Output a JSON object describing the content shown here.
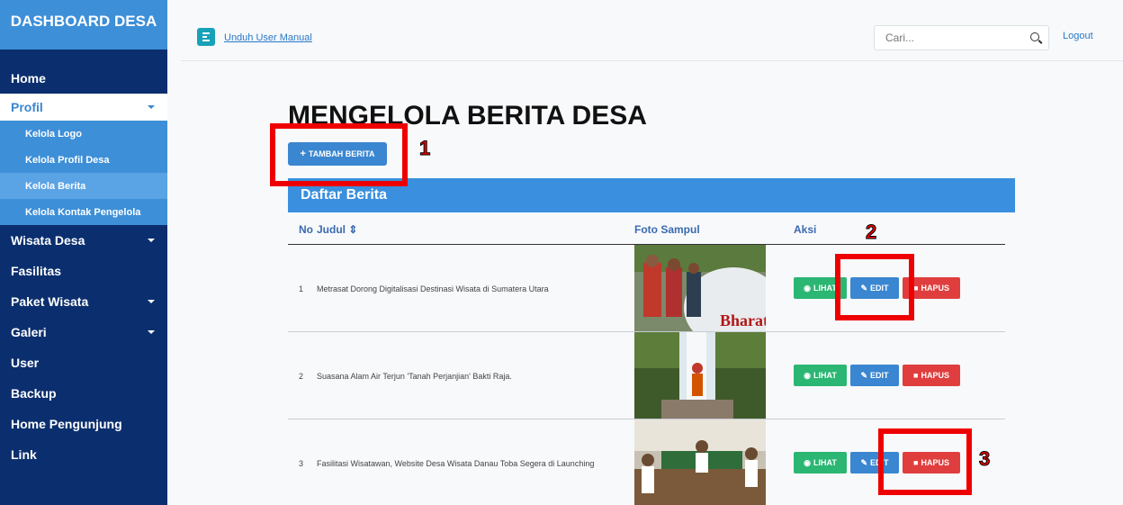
{
  "sidebar": {
    "brand": "DASHBOARD DESA",
    "items": [
      {
        "label": "Home"
      },
      {
        "label": "Profil"
      },
      {
        "label": "Kelola Logo"
      },
      {
        "label": "Kelola Profil Desa"
      },
      {
        "label": "Kelola Berita"
      },
      {
        "label": "Kelola Kontak Pengelola"
      },
      {
        "label": "Wisata Desa"
      },
      {
        "label": "Fasilitas"
      },
      {
        "label": "Paket Wisata"
      },
      {
        "label": "Galeri"
      },
      {
        "label": "User"
      },
      {
        "label": "Backup"
      },
      {
        "label": "Home Pengunjung"
      },
      {
        "label": "Link"
      }
    ]
  },
  "topbar": {
    "manual_link": "Unduh User Manual",
    "search_placeholder": "Cari...",
    "logout": "Logout"
  },
  "main": {
    "title": "MENGELOLA BERITA DESA",
    "add_button": "TAMBAH BERITA",
    "card_title": "Daftar Berita",
    "columns": {
      "no": "No",
      "judul": "Judul ⇕",
      "foto": "Foto Sampul",
      "aksi": "Aksi"
    },
    "rows": [
      {
        "no": "1",
        "title": "Metrasat Dorong Digitalisasi Destinasi Wisata di Sumatera Utara"
      },
      {
        "no": "2",
        "title": "Suasana Alam Air Terjun 'Tanah Perjanjian' Bakti Raja."
      },
      {
        "no": "3",
        "title": "Fasilitasi Wisatawan, Website Desa Wisata Danau Toba Segera di Launching"
      }
    ],
    "actions": {
      "view": "LIHAT",
      "edit": "EDIT",
      "delete": "HAPUS"
    }
  },
  "annotations": {
    "label1": "1",
    "label2": "2",
    "label3": "3"
  },
  "colors": {
    "sidebar": "#0b2f6e",
    "brand": "#3d8fd8",
    "primary": "#3a86d0",
    "success": "#2bb673",
    "danger": "#e03e3e",
    "annotation": "#ef0000"
  }
}
